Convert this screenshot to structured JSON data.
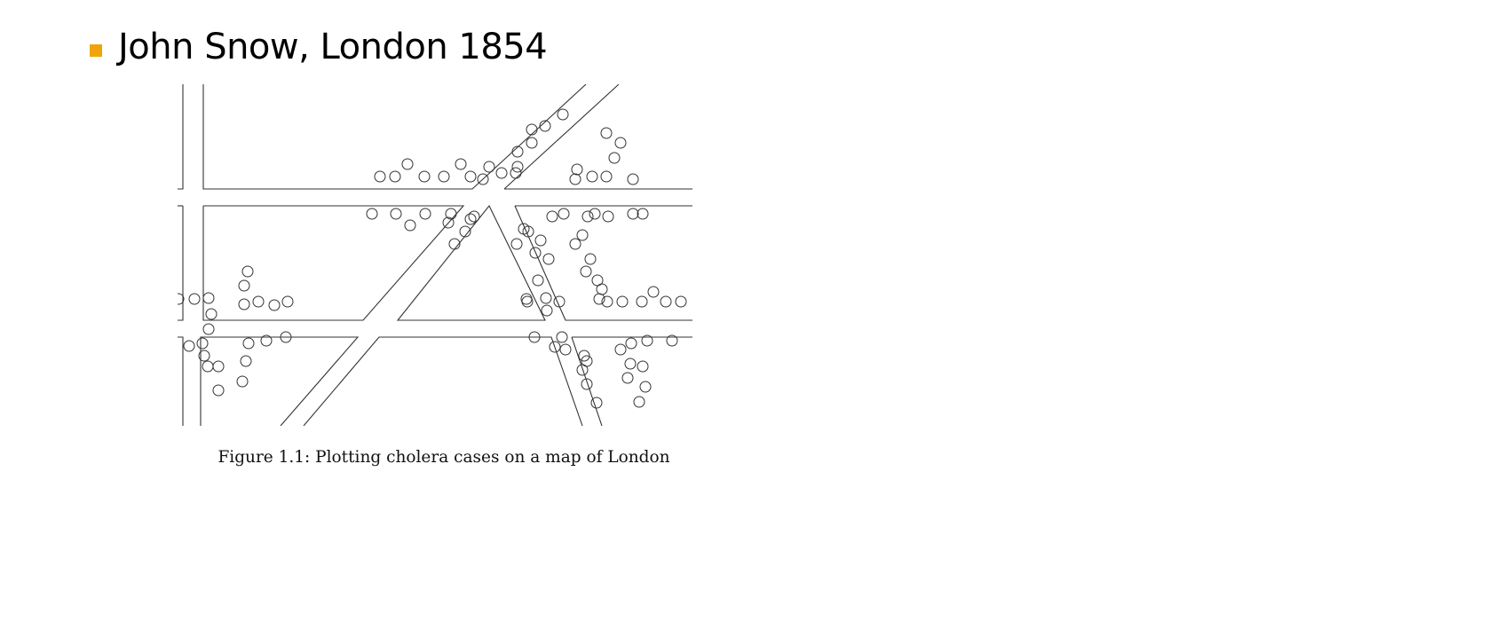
{
  "slide": {
    "bullet_color": "#f0a30a",
    "title": "John Snow, London 1854"
  },
  "figure": {
    "caption": "Figure 1.1: Plotting cholera cases on a map of London"
  }
}
